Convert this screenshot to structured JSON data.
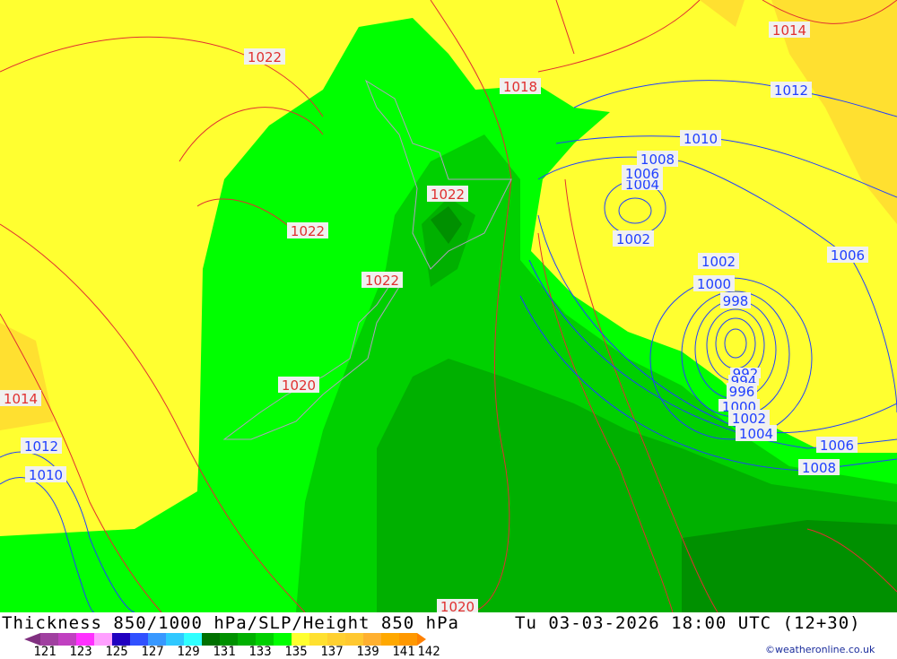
{
  "title": "Thickness 850/1000 hPa/SLP/Height 850 hPa",
  "datetime": "Tu 03-03-2026 18:00 UTC (12+30)",
  "credit": "©weatheronline.co.uk",
  "legend": {
    "colors": [
      "#a040a0",
      "#c040c0",
      "#ff30ff",
      "#ffa0ff",
      "#2000c0",
      "#3050ff",
      "#3898ff",
      "#30c8ff",
      "#30ffff",
      "#007000",
      "#009000",
      "#00b000",
      "#00d000",
      "#00ff00",
      "#ffff30",
      "#ffe030",
      "#ffd030",
      "#ffc830",
      "#ffb030",
      "#ffa800",
      "#ff9800"
    ],
    "arrow_low": "#803080",
    "arrow_high": "#ff8000",
    "ticks": [
      "121",
      "123",
      "125",
      "127",
      "129",
      "131",
      "133",
      "135",
      "137",
      "139",
      "141",
      "142"
    ]
  },
  "isobars_red": [
    "1014",
    "1022",
    "1018",
    "1022",
    "1022",
    "1022",
    "1014",
    "1020",
    "1020"
  ],
  "isobars_blue": [
    "1012",
    "1010",
    "1008",
    "1006",
    "1004",
    "1002",
    "1002",
    "1000",
    "998",
    "1006",
    "992",
    "994",
    "996",
    "1000",
    "1002",
    "1004",
    "1006",
    "1008",
    "1012",
    "1010"
  ],
  "colors": {
    "slp_line": "#e03030",
    "height_line": "#2040ff",
    "coast": "#b0a0c0"
  }
}
